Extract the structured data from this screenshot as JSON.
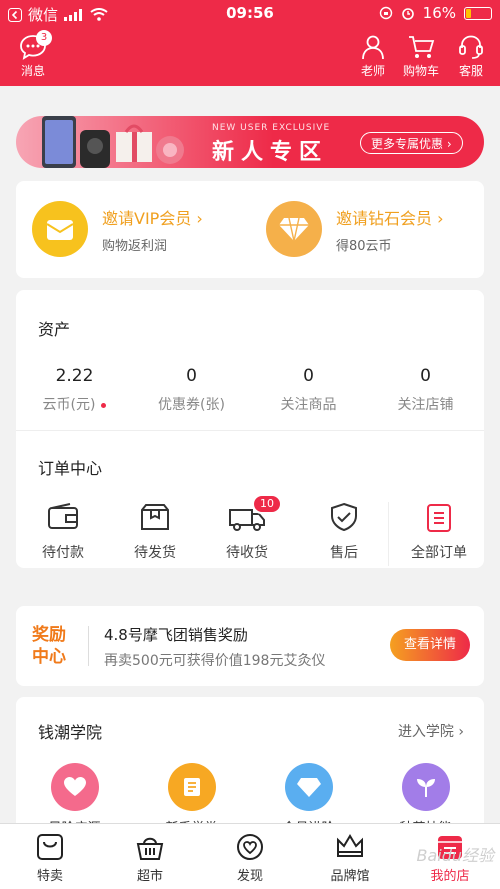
{
  "status_bar": {
    "back_app": "微信",
    "time": "09:56",
    "battery": "16%"
  },
  "top_bar": {
    "messages": {
      "label": "消息",
      "badge": "3"
    },
    "teacher": "老师",
    "cart": "购物车",
    "service": "客服"
  },
  "banner": {
    "sub": "NEW USER EXCLUSIVE",
    "title": "新人专区",
    "more": "更多专属优惠 ›"
  },
  "vip": [
    {
      "title": "邀请VIP会员 ›",
      "sub": "购物返利润"
    },
    {
      "title": "邀请钻石会员 ›",
      "sub": "得80云币"
    }
  ],
  "assets": {
    "title": "资产",
    "stats": [
      {
        "value": "2.22",
        "label": "云币(元)"
      },
      {
        "value": "0",
        "label": "优惠券(张)"
      },
      {
        "value": "0",
        "label": "关注商品"
      },
      {
        "value": "0",
        "label": "关注店铺"
      }
    ]
  },
  "orders": {
    "title": "订单中心",
    "items": [
      {
        "label": "待付款"
      },
      {
        "label": "待发货"
      },
      {
        "label": "待收货",
        "badge": "10"
      },
      {
        "label": "售后"
      },
      {
        "label": "全部订单"
      }
    ]
  },
  "reward": {
    "tag_line1": "奖励",
    "tag_line2": "中心",
    "title": "4.8号摩飞团销售奖励",
    "sub": "再卖500元可获得价值198元艾灸仪",
    "button": "查看详情"
  },
  "academy": {
    "title": "钱潮学院",
    "more": "进入学院 ›",
    "items": [
      "风险应源",
      "新手学堂",
      "会员进阶",
      "种草技能"
    ]
  },
  "tabs": [
    "特卖",
    "超市",
    "发现",
    "品牌馆",
    "我的店"
  ],
  "watermark": "Baidu经验",
  "colors": {
    "brand": "#ee2a48",
    "gold": "#f0a020",
    "orange": "#f07a1a"
  }
}
